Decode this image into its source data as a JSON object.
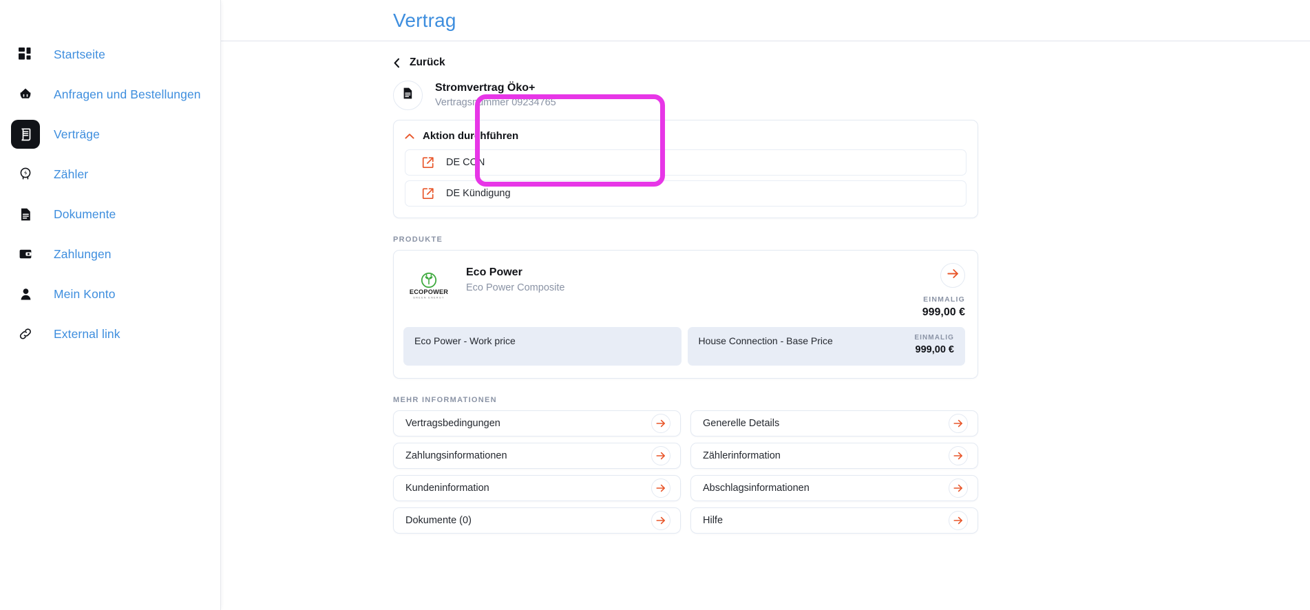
{
  "sidebar": {
    "items": [
      {
        "label": "Startseite",
        "icon": "grid-icon",
        "active": false
      },
      {
        "label": "Anfragen und Bestellungen",
        "icon": "basket-icon",
        "active": false
      },
      {
        "label": "Verträge",
        "icon": "contract-icon",
        "active": true
      },
      {
        "label": "Zähler",
        "icon": "meter-icon",
        "active": false
      },
      {
        "label": "Dokumente",
        "icon": "document-icon",
        "active": false
      },
      {
        "label": "Zahlungen",
        "icon": "wallet-icon",
        "active": false
      },
      {
        "label": "Mein Konto",
        "icon": "person-icon",
        "active": false
      },
      {
        "label": "External link",
        "icon": "link-icon",
        "active": false
      }
    ]
  },
  "header": {
    "title": "Vertrag",
    "title_color": "#3e8ede"
  },
  "back": {
    "label": "Zurück",
    "icon": "chevron-left-icon"
  },
  "contract": {
    "icon": "document-icon",
    "name": "Stromvertrag Öko+",
    "number": "Vertragsnummer 09234765"
  },
  "action_panel": {
    "title": "Aktion durchführen",
    "caret": "chevron-up-icon",
    "accent": "#e8562a",
    "highlight_color": "#e736e7",
    "items": [
      {
        "label": "DE CON",
        "icon": "external-link-icon"
      },
      {
        "label": "DE Kündigung",
        "icon": "external-link-icon"
      }
    ]
  },
  "products": {
    "section_label": "PRODUKTE",
    "card": {
      "logo_text": "ECOPOWER",
      "name": "Eco Power",
      "subtitle": "Eco Power Composite",
      "arrow_icon": "arrow-right-icon",
      "price_tag": "EINMALIG",
      "price_value": "999,00 €",
      "rows": [
        {
          "name": "Eco Power - Work price",
          "tag": "",
          "value": ""
        },
        {
          "name": "House Connection - Base Price",
          "tag": "EINMALIG",
          "value": "999,00 €"
        }
      ]
    }
  },
  "more_info": {
    "section_label": "MEHR INFORMATIONEN",
    "items": [
      {
        "label": "Vertragsbedingungen",
        "icon": "arrow-right-icon"
      },
      {
        "label": "Generelle Details",
        "icon": "arrow-right-icon"
      },
      {
        "label": "Zahlungsinformationen",
        "icon": "arrow-right-icon"
      },
      {
        "label": "Zählerinformation",
        "icon": "arrow-right-icon"
      },
      {
        "label": "Kundeninformation",
        "icon": "arrow-right-icon"
      },
      {
        "label": "Abschlagsinformationen",
        "icon": "arrow-right-icon"
      },
      {
        "label": "Dokumente (0)",
        "icon": "arrow-right-icon"
      },
      {
        "label": "Hilfe",
        "icon": "arrow-right-icon"
      }
    ]
  }
}
